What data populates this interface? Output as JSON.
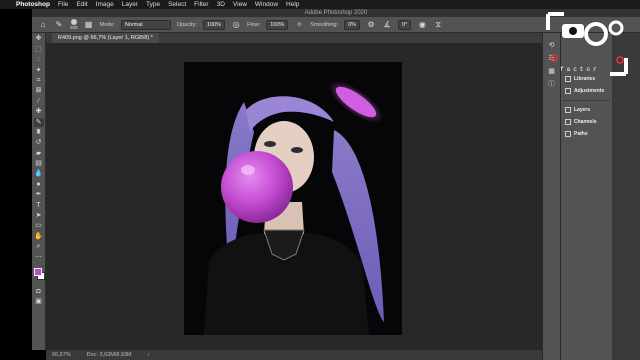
{
  "menubar": {
    "apple": "",
    "app": "Photoshop",
    "items": [
      "File",
      "Edit",
      "Image",
      "Layer",
      "Type",
      "Select",
      "Filter",
      "3D",
      "View",
      "Window",
      "Help"
    ]
  },
  "window_title": "Adobe Photoshop 2020",
  "options_bar": {
    "brush_size": "200",
    "mode_label": "Mode:",
    "mode_value": "Normal",
    "opacity_label": "Opacity:",
    "opacity_value": "100%",
    "flow_label": "Flow:",
    "flow_value": "100%",
    "smoothing_label": "Smoothing:",
    "smoothing_value": "0%",
    "angle_value": "0°"
  },
  "document_tab": "R409.png @ 66,7% (Layer 1, RGB/8) *",
  "status_bar": {
    "zoom": "66,67%",
    "doc": "Doc: 3,63M/8,93M"
  },
  "panels": {
    "items": [
      "Libraries",
      "Adjustments",
      "Layers",
      "Channels",
      "Paths"
    ]
  },
  "colors": {
    "foreground": "#b94fc8",
    "background": "#ffffff",
    "bubble": "#c94bd6"
  },
  "watermark": {
    "text": "factor"
  }
}
